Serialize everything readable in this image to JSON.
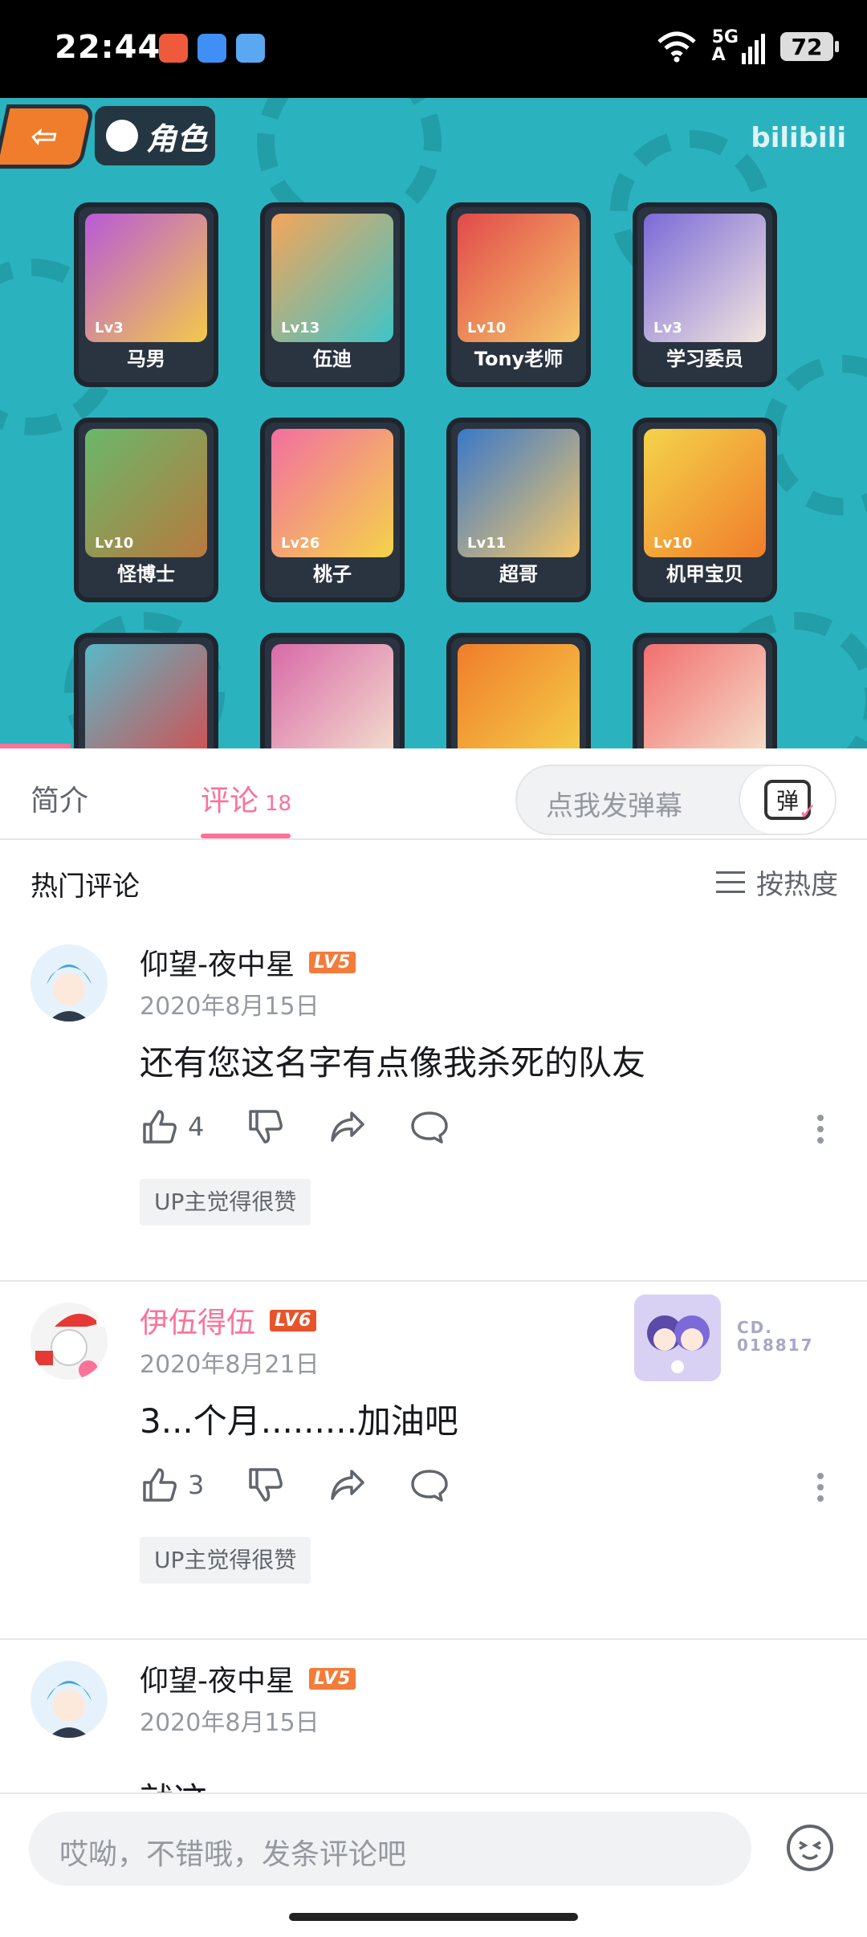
{
  "status_bar": {
    "time": "22:44",
    "signal": "5G",
    "signal_sub": "A",
    "battery": "72"
  },
  "video": {
    "watermark": "bilibili",
    "role_label": "角色",
    "progress_percent": 8,
    "characters": [
      {
        "name": "马男",
        "level": "Lv3"
      },
      {
        "name": "伍迪",
        "level": "Lv13"
      },
      {
        "name": "Tony老师",
        "level": "Lv10"
      },
      {
        "name": "学习委员",
        "level": "Lv3"
      },
      {
        "name": "怪博士",
        "level": "Lv10"
      },
      {
        "name": "桃子",
        "level": "Lv26"
      },
      {
        "name": "超哥",
        "level": "Lv11"
      },
      {
        "name": "机甲宝贝",
        "level": "Lv10"
      }
    ]
  },
  "tabs": {
    "intro": "简介",
    "comments": "评论",
    "comments_count": "18",
    "danmaku_placeholder": "点我发弹幕",
    "danmaku_icon": "弹"
  },
  "hot_header": {
    "title": "热门评论",
    "sort_label": "按热度"
  },
  "comments": [
    {
      "user": "仰望-夜中星",
      "level": "LV5",
      "date": "2020年8月15日",
      "text": "还有您这名字有点像我杀死的队友",
      "likes": "4",
      "tag": "UP主觉得很赞"
    },
    {
      "user": "伊伍得伍",
      "level": "LV6",
      "date": "2020年8月21日",
      "text": "3...个月.........加油吧",
      "likes": "3",
      "tag": "UP主觉得很赞",
      "fan_no_line1": "CD.",
      "fan_no_line2": "018817"
    },
    {
      "user": "仰望-夜中星",
      "level": "LV5",
      "date": "2020年8月15日",
      "text": "就这"
    }
  ],
  "bottom": {
    "reply_placeholder": "哎呦，不错哦，发条评论吧"
  },
  "colors": {
    "accent": "#fb7299",
    "video_bg": "#2ab3bf",
    "level_badge": "#f37c3b"
  }
}
